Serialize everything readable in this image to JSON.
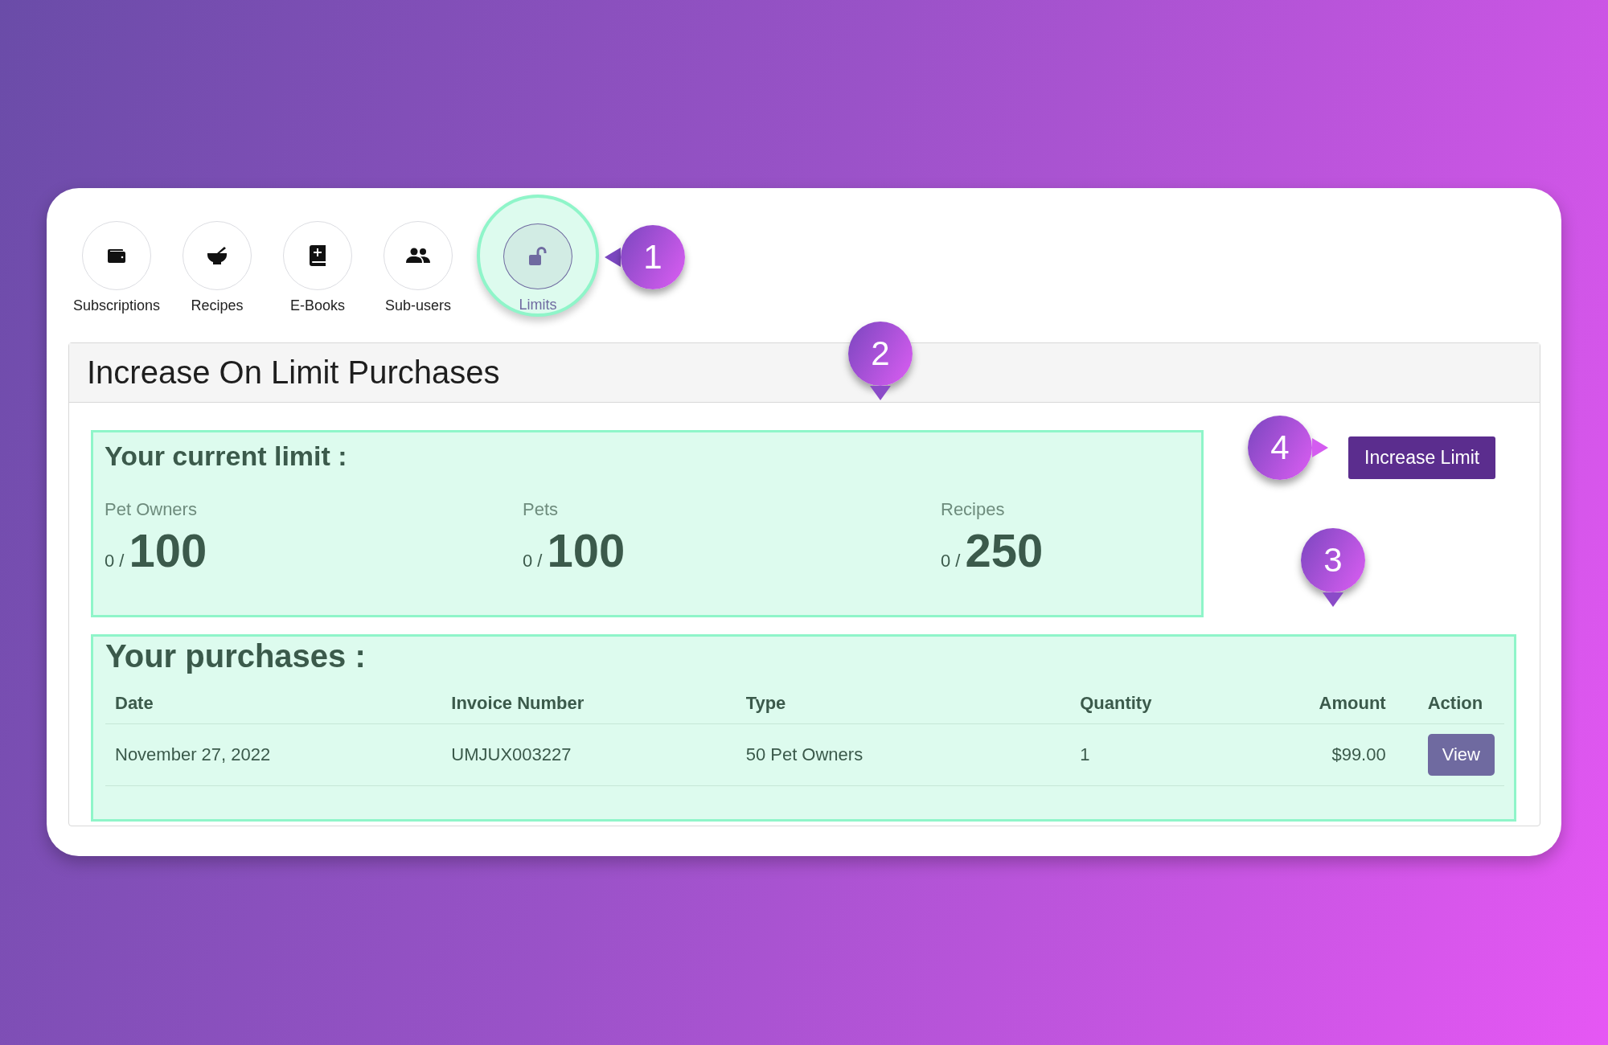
{
  "tabs": [
    {
      "label": "Subscriptions",
      "selected": false
    },
    {
      "label": "Recipes",
      "selected": false
    },
    {
      "label": "E-Books",
      "selected": false
    },
    {
      "label": "Sub-users",
      "selected": false
    },
    {
      "label": "Limits",
      "selected": true
    }
  ],
  "panel": {
    "title": "Increase On Limit Purchases"
  },
  "current_limit": {
    "heading": "Your current limit :",
    "items": [
      {
        "label": "Pet Owners",
        "used": "0 /",
        "limit": "100"
      },
      {
        "label": "Pets",
        "used": "0 /",
        "limit": "100"
      },
      {
        "label": "Recipes",
        "used": "0 /",
        "limit": "250"
      }
    ]
  },
  "increase_button": "Increase Limit",
  "purchases": {
    "heading": "Your purchases :",
    "columns": [
      "Date",
      "Invoice Number",
      "Type",
      "Quantity",
      "Amount",
      "Action"
    ],
    "rows": [
      {
        "cells": [
          "November 27, 2022",
          "UMJUX003227",
          "50 Pet Owners",
          "1",
          "$99.00"
        ],
        "action": "View"
      }
    ]
  },
  "callouts": [
    {
      "number": "1",
      "kind": "left"
    },
    {
      "number": "2",
      "kind": "down"
    },
    {
      "number": "3",
      "kind": "down"
    },
    {
      "number": "4",
      "kind": "right"
    }
  ]
}
